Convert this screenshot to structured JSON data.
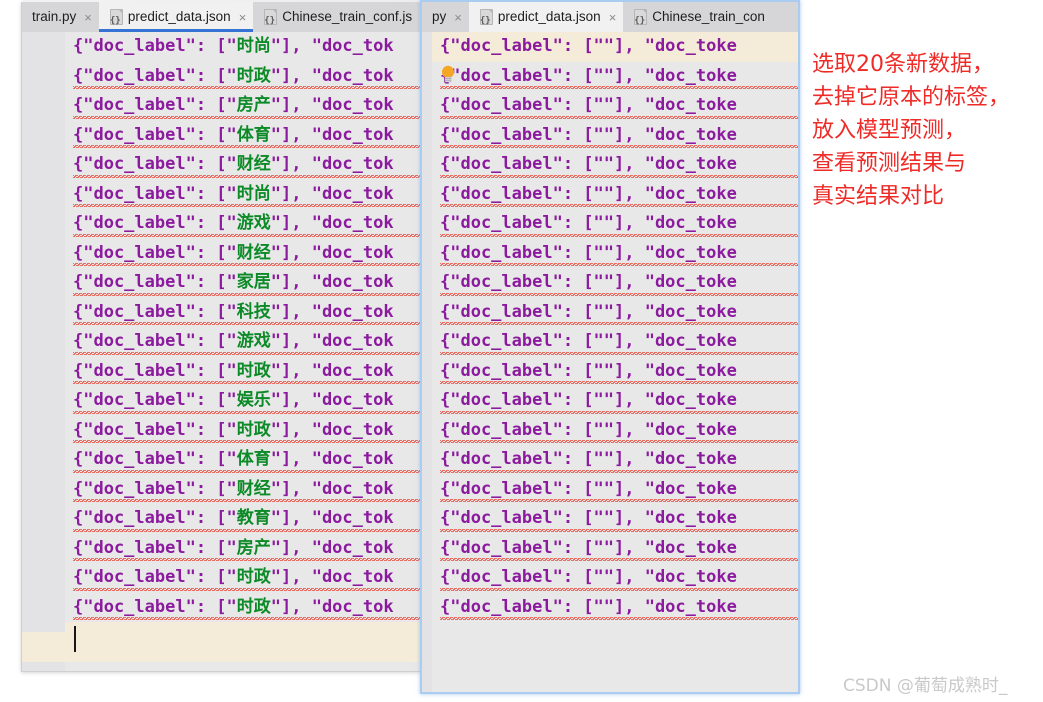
{
  "window_title_ghost": "File  Edit  View",
  "left_panel": {
    "name": "left-editor",
    "tabs": [
      {
        "label": "train.py",
        "icon": "python-file-icon",
        "selected": false,
        "has_icon": false,
        "closable": true
      },
      {
        "label": "predict_data.json",
        "icon": "json-file-icon",
        "selected": true,
        "has_icon": true,
        "closable": true,
        "active": true
      },
      {
        "label": "Chinese_train_conf.js",
        "icon": "json-file-icon",
        "selected": false,
        "has_icon": true,
        "closable": false
      }
    ],
    "close_glyph": "×",
    "lines": [
      {
        "prefix": "{\"doc_label\": [\"",
        "value": "时尚",
        "suffix": "\"], \"doc_tok",
        "error": false
      },
      {
        "prefix": "{\"doc_label\": [\"",
        "value": "时政",
        "suffix": "\"], \"doc_tok",
        "error": true
      },
      {
        "prefix": "{\"doc_label\": [\"",
        "value": "房产",
        "suffix": "\"], \"doc_tok",
        "error": true
      },
      {
        "prefix": "{\"doc_label\": [\"",
        "value": "体育",
        "suffix": "\"], \"doc_tok",
        "error": true
      },
      {
        "prefix": "{\"doc_label\": [\"",
        "value": "财经",
        "suffix": "\"], \"doc_tok",
        "error": true
      },
      {
        "prefix": "{\"doc_label\": [\"",
        "value": "时尚",
        "suffix": "\"], \"doc_tok",
        "error": true
      },
      {
        "prefix": "{\"doc_label\": [\"",
        "value": "游戏",
        "suffix": "\"], \"doc_tok",
        "error": true
      },
      {
        "prefix": "{\"doc_label\": [\"",
        "value": "财经",
        "suffix": "\"], \"doc_tok",
        "error": true
      },
      {
        "prefix": "{\"doc_label\": [\"",
        "value": "家居",
        "suffix": "\"], \"doc_tok",
        "error": true
      },
      {
        "prefix": "{\"doc_label\": [\"",
        "value": "科技",
        "suffix": "\"], \"doc_tok",
        "error": true
      },
      {
        "prefix": "{\"doc_label\": [\"",
        "value": "游戏",
        "suffix": "\"], \"doc_tok",
        "error": true
      },
      {
        "prefix": "{\"doc_label\": [\"",
        "value": "时政",
        "suffix": "\"], \"doc_tok",
        "error": true
      },
      {
        "prefix": "{\"doc_label\": [\"",
        "value": "娱乐",
        "suffix": "\"], \"doc_tok",
        "error": true
      },
      {
        "prefix": "{\"doc_label\": [\"",
        "value": "时政",
        "suffix": "\"], \"doc_tok",
        "error": true
      },
      {
        "prefix": "{\"doc_label\": [\"",
        "value": "体育",
        "suffix": "\"], \"doc_tok",
        "error": true
      },
      {
        "prefix": "{\"doc_label\": [\"",
        "value": "财经",
        "suffix": "\"], \"doc_tok",
        "error": true
      },
      {
        "prefix": "{\"doc_label\": [\"",
        "value": "教育",
        "suffix": "\"], \"doc_tok",
        "error": true
      },
      {
        "prefix": "{\"doc_label\": [\"",
        "value": "房产",
        "suffix": "\"], \"doc_tok",
        "error": true
      },
      {
        "prefix": "{\"doc_label\": [\"",
        "value": "时政",
        "suffix": "\"], \"doc_tok",
        "error": true
      },
      {
        "prefix": "{\"doc_label\": [\"",
        "value": "时政",
        "suffix": "\"], \"doc_tok",
        "error": true
      }
    ],
    "caret_line_empty": true
  },
  "right_panel": {
    "name": "right-editor",
    "tabs": [
      {
        "label": "py",
        "icon": "python-file-icon",
        "selected": false,
        "has_icon": false,
        "closable": true
      },
      {
        "label": "predict_data.json",
        "icon": "json-file-icon",
        "selected": true,
        "has_icon": true,
        "closable": true,
        "active": false
      },
      {
        "label": "Chinese_train_con",
        "icon": "json-file-icon",
        "selected": false,
        "has_icon": true,
        "closable": false
      }
    ],
    "close_glyph": "×",
    "hint_icon": "lightbulb-icon",
    "hint_icon_line": 2,
    "lines": [
      {
        "prefix": "{\"doc_label\": [\"",
        "value": "",
        "suffix": "\"], \"doc_toke",
        "error": false,
        "highlighted": true
      },
      {
        "prefix": "{\"doc_label\": [\"",
        "value": "",
        "suffix": "\"], \"doc_toke",
        "error": true
      },
      {
        "prefix": "{\"doc_label\": [\"",
        "value": "",
        "suffix": "\"], \"doc_toke",
        "error": true
      },
      {
        "prefix": "{\"doc_label\": [\"",
        "value": "",
        "suffix": "\"], \"doc_toke",
        "error": true
      },
      {
        "prefix": "{\"doc_label\": [\"",
        "value": "",
        "suffix": "\"], \"doc_toke",
        "error": true
      },
      {
        "prefix": "{\"doc_label\": [\"",
        "value": "",
        "suffix": "\"], \"doc_toke",
        "error": true
      },
      {
        "prefix": "{\"doc_label\": [\"",
        "value": "",
        "suffix": "\"], \"doc_toke",
        "error": true
      },
      {
        "prefix": "{\"doc_label\": [\"",
        "value": "",
        "suffix": "\"], \"doc_toke",
        "error": true
      },
      {
        "prefix": "{\"doc_label\": [\"",
        "value": "",
        "suffix": "\"], \"doc_toke",
        "error": true
      },
      {
        "prefix": "{\"doc_label\": [\"",
        "value": "",
        "suffix": "\"], \"doc_toke",
        "error": true
      },
      {
        "prefix": "{\"doc_label\": [\"",
        "value": "",
        "suffix": "\"], \"doc_toke",
        "error": true
      },
      {
        "prefix": "{\"doc_label\": [\"",
        "value": "",
        "suffix": "\"], \"doc_toke",
        "error": true
      },
      {
        "prefix": "{\"doc_label\": [\"",
        "value": "",
        "suffix": "\"], \"doc_toke",
        "error": true
      },
      {
        "prefix": "{\"doc_label\": [\"",
        "value": "",
        "suffix": "\"], \"doc_toke",
        "error": true
      },
      {
        "prefix": "{\"doc_label\": [\"",
        "value": "",
        "suffix": "\"], \"doc_toke",
        "error": true
      },
      {
        "prefix": "{\"doc_label\": [\"",
        "value": "",
        "suffix": "\"], \"doc_toke",
        "error": true
      },
      {
        "prefix": "{\"doc_label\": [\"",
        "value": "",
        "suffix": "\"], \"doc_toke",
        "error": true
      },
      {
        "prefix": "{\"doc_label\": [\"",
        "value": "",
        "suffix": "\"], \"doc_toke",
        "error": true
      },
      {
        "prefix": "{\"doc_label\": [\"",
        "value": "",
        "suffix": "\"], \"doc_toke",
        "error": true
      },
      {
        "prefix": "{\"doc_label\": [\"",
        "value": "",
        "suffix": "\"], \"doc_toke",
        "error": true
      }
    ]
  },
  "annotation": {
    "text": "选取20条新数据，\n去掉它原本的标签，\n放入模型预测，\n查看预测结果与\n真实结果对比",
    "color": "#ef2b28"
  },
  "watermark": {
    "text": "CSDN @葡萄成熟时_",
    "color": "#c9c9c9"
  },
  "colors": {
    "tab_bar_bg": "#d6d6d8",
    "selected_tab_bg": "#f1f1f1",
    "active_tab_underline": "#3574d4",
    "editor_bg": "#e8e8e8",
    "highlight_line_bg": "#f4ecd8",
    "focus_border": "#a9ccf0",
    "key_token": "#8b1a9e",
    "value_token": "#0c8a27",
    "punctuation_token": "#17171a",
    "error_squiggle": "#e83b2e"
  }
}
